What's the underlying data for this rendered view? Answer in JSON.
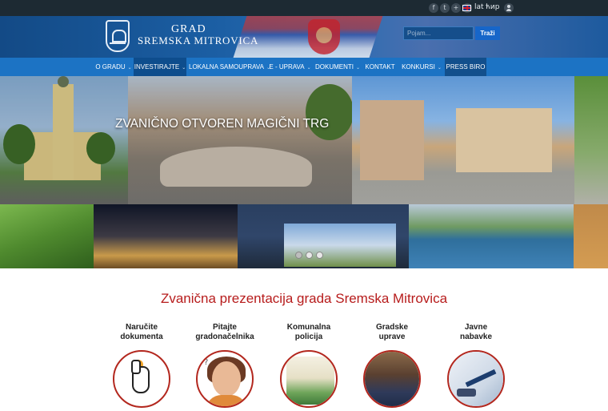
{
  "topbar": {
    "social": [
      "f",
      "t",
      "+",
      "v"
    ],
    "lang_lat": "lat",
    "lang_cyr": "ћир"
  },
  "header": {
    "brand_line1": "GRAD",
    "brand_line2": "SREMSKA MITROVICA",
    "search_placeholder": "Pojam...",
    "search_button": "Traži"
  },
  "nav": {
    "items": [
      {
        "label": "O GRADU",
        "dropdown": true
      },
      {
        "label": "INVESTIRAJTE",
        "dropdown": true
      },
      {
        "label": "LOKALNA SAMOUPRAVA",
        "dropdown": true
      },
      {
        "label": "E - UPRAVA",
        "dropdown": true
      },
      {
        "label": "DOKUMENTI",
        "dropdown": true
      },
      {
        "label": "KONTAKT",
        "dropdown": false
      },
      {
        "label": "KONKURSI",
        "dropdown": true
      },
      {
        "label": "PRESS BIRO",
        "dropdown": false
      }
    ]
  },
  "hero": {
    "caption": "ZVANIČNO OTVOREN MAGIČNI TRG"
  },
  "main": {
    "intro": "Zvanična prezentacija grada Sremska Mitrovica",
    "services": [
      {
        "label": "Naručite\ndokumenta",
        "icon": "pointer-hand-icon"
      },
      {
        "label": "Pitajte\ngradonačelnika",
        "icon": "thinking-woman-icon"
      },
      {
        "label": "Komunalna\npolicija",
        "icon": "poster-icon"
      },
      {
        "label": "Gradske\nuprave",
        "icon": "meeting-icon"
      },
      {
        "label": "Javne\nnabavke",
        "icon": "document-pen-icon"
      }
    ]
  },
  "colors": {
    "nav_bg": "#1c73c4",
    "intro_text": "#b71c1c",
    "circle_border": "#b3271e"
  }
}
